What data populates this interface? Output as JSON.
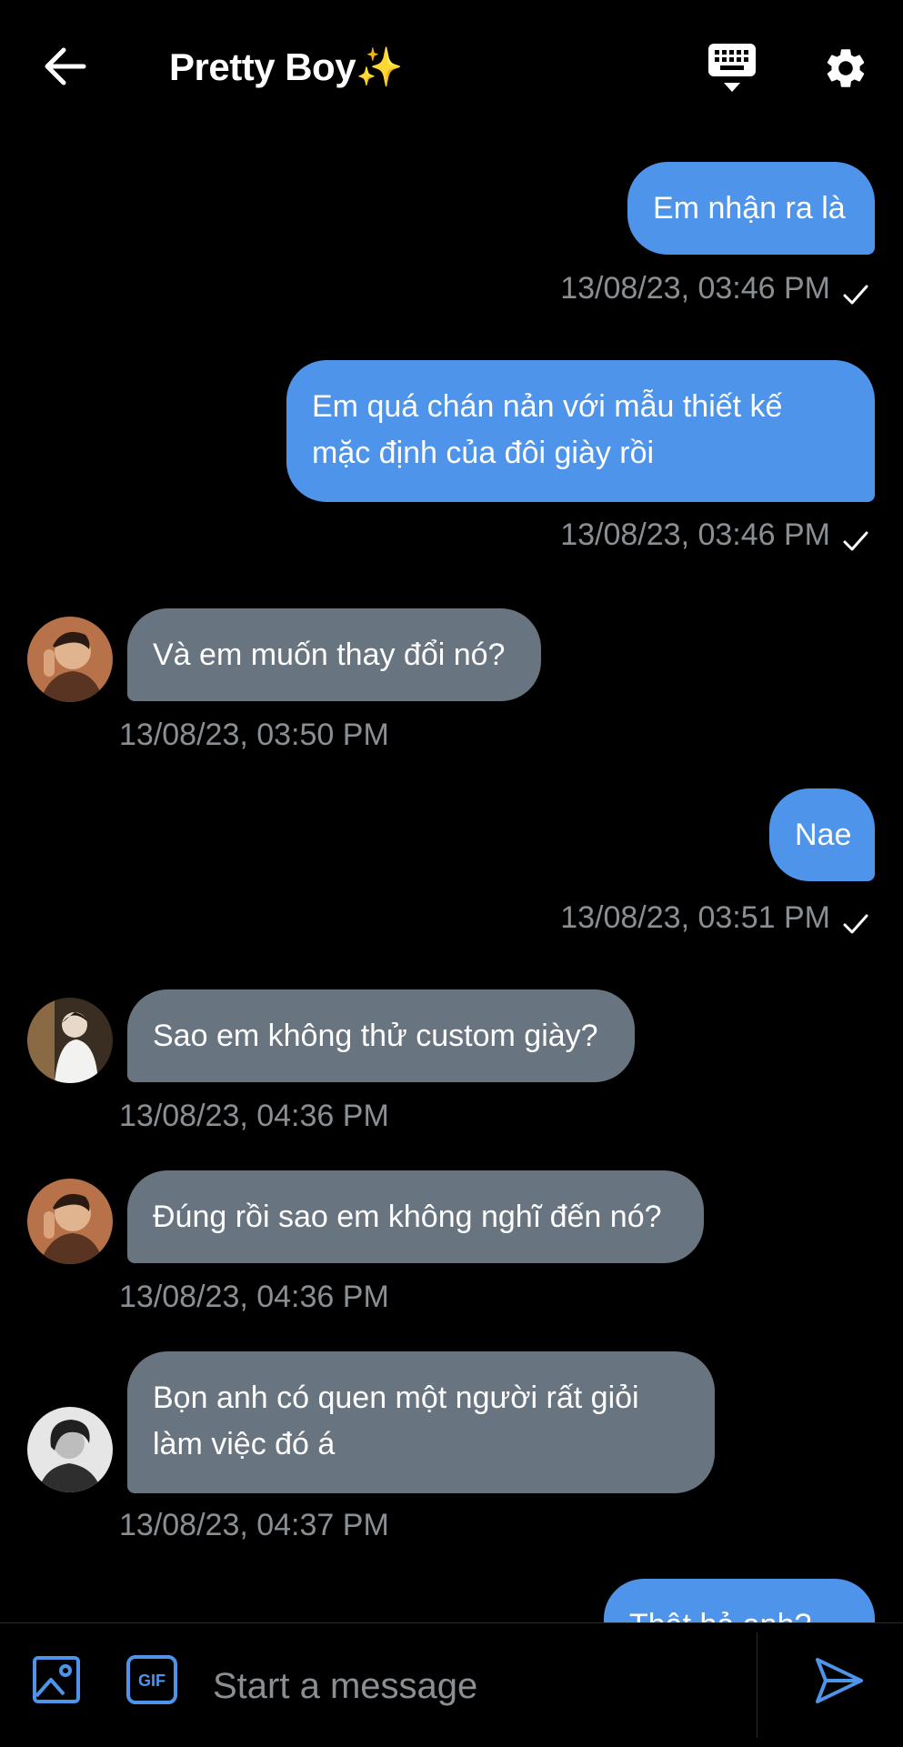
{
  "header": {
    "title": "Pretty Boy✨"
  },
  "icons": {
    "back": "arrow-left-icon",
    "keyboard": "keyboard-icon",
    "settings": "gear-icon",
    "image": "image-icon",
    "gif": "gif-icon",
    "send": "send-icon",
    "read": "check-icon"
  },
  "colors": {
    "background": "#000000",
    "outgoing_bubble": "#4d94ea",
    "incoming_bubble": "#68747f",
    "timestamp": "#8a8f94"
  },
  "messages": [
    {
      "direction": "out",
      "lines": [
        "Em nhận ra là"
      ],
      "time": "13/08/23, 03:46 PM"
    },
    {
      "direction": "out",
      "lines": [
        "Em quá chán nản với mẫu thiết kế",
        "mặc định của đôi giày rồi"
      ],
      "time": "13/08/23, 03:46 PM"
    },
    {
      "direction": "in",
      "lines": [
        "Và em muốn thay đổi nó?"
      ],
      "time": "13/08/23, 03:50 PM"
    },
    {
      "direction": "out",
      "lines": [
        "Nae"
      ],
      "time": "13/08/23, 03:51 PM"
    },
    {
      "direction": "in",
      "lines": [
        "Sao em không thử custom giày?"
      ],
      "time": "13/08/23, 04:36 PM"
    },
    {
      "direction": "in",
      "lines": [
        "Đúng rồi sao em không nghĩ đến nó?"
      ],
      "time": "13/08/23, 04:36 PM"
    },
    {
      "direction": "in",
      "lines": [
        "Bọn anh có quen một người rất giỏi",
        "làm việc đó á"
      ],
      "time": "13/08/23, 04:37 PM"
    },
    {
      "direction": "out",
      "lines": [
        "Thật hả anh?"
      ],
      "time": ""
    }
  ],
  "composer": {
    "placeholder": "Start a message",
    "gif_label": "GIF"
  }
}
